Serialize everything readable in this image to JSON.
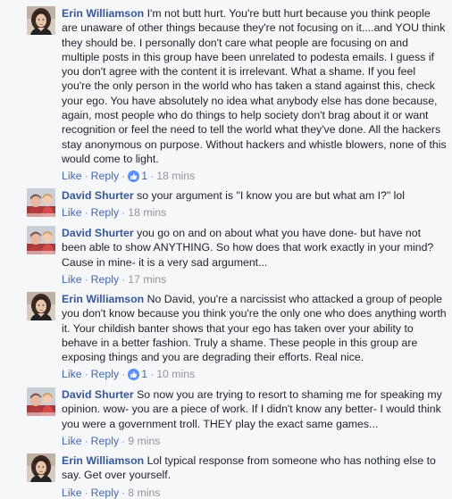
{
  "labels": {
    "like": "Like",
    "reply": "Reply",
    "dot": "·"
  },
  "comments": [
    {
      "author": "Erin Williamson",
      "text": "I'm not butt hurt. You're butt hurt because you think people are unaware of other things because they're not focusing on it....and YOU think they should be. I personally don't care what people are focusing on and multiple posts in this group have been unrelated to podesta emails. I guess if you don't agree with the content it is irrelevant. What a shame. If you feel you're the only person in the world who has taken a stand against this, check your ego. You have absolutely no idea what anybody else has done because, again, most people who do things to help society don't brag about it or want recognition or feel the need to tell the world what they've done. All the hackers stay anonymous on purpose. Without hackers and whistle blowers, none of this would come to light.",
      "reactions": "1",
      "time": "18 mins"
    },
    {
      "author": "David Shurter",
      "text": "so your argument is \"I know you are but what am I?\" lol",
      "time": "18 mins"
    },
    {
      "author": "David Shurter",
      "text": "you go on and on about what you have done- but have not been able to show ANYTHING. So how does that work exactly in your mind? Cause in mine- it is a very sad argument...",
      "time": "17 mins"
    },
    {
      "author": "Erin Williamson",
      "text": "No David, you're a narcissist who attacked a group of people you don't know because you think you're the only one who does anything worth it. Your childish banter shows that your ego has taken over your ability to behave in a better fashion. Truly a shame. These people in this group are exposing things and you are degrading their efforts. Real nice.",
      "reactions": "1",
      "time": "10 mins"
    },
    {
      "author": "David Shurter",
      "text": "So now you are trying to resort to shaming me for speaking my opinion. wow- you are a piece of work. If I didn't know any better- I would think you were a government troll. THEY play the exact same games...",
      "time": "9 mins"
    },
    {
      "author": "Erin Williamson",
      "text": "Lol typical response from someone who has nothing else to say. Get over yourself.",
      "time": "8 mins"
    }
  ],
  "colors": {
    "author": "#365899",
    "link": "#4267b2",
    "meta": "#90949c",
    "text": "#1d2129",
    "background": "#f6f7f9",
    "reaction": "#5890ff"
  }
}
